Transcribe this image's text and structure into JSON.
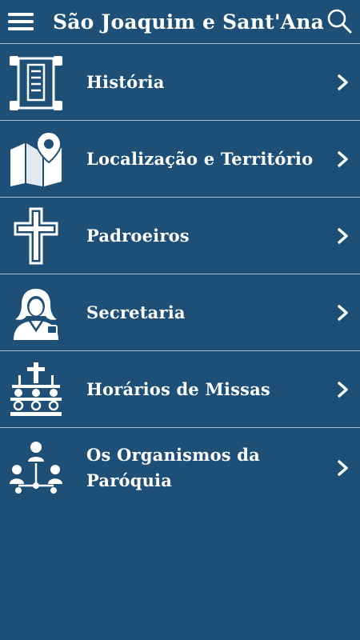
{
  "app": {
    "title": "São Joaquim e Sant'Ana"
  },
  "colors": {
    "background": "#1d4f77",
    "divider": "#a8c0d4",
    "foreground": "#ffffff"
  },
  "menu": {
    "items": [
      {
        "label": "História",
        "icon": "scroll-icon"
      },
      {
        "label": "Localização e Território",
        "icon": "map-pin-icon"
      },
      {
        "label": "Padroeiros",
        "icon": "cross-icon"
      },
      {
        "label": "Secretaria",
        "icon": "secretary-icon"
      },
      {
        "label": "Horários de Missas",
        "icon": "mass-congregation-icon"
      },
      {
        "label": "Os Organismos da Paróquia",
        "icon": "organization-icon"
      }
    ]
  }
}
